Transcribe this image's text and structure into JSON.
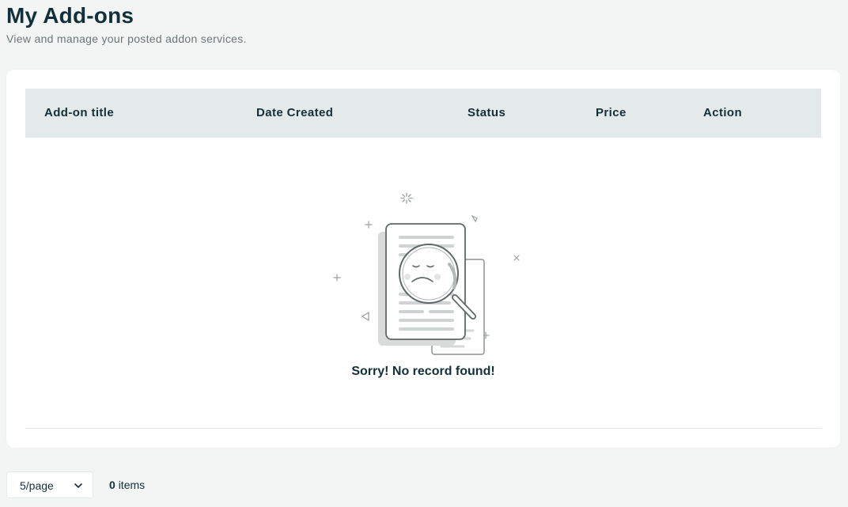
{
  "header": {
    "title": "My Add-ons",
    "subtitle": "View and manage your posted addon services."
  },
  "table": {
    "columns": [
      "Add-on title",
      "Date Created",
      "Status",
      "Price",
      "Action"
    ],
    "rows": []
  },
  "empty_state": {
    "illustration": "document-magnifier-sad-icon",
    "message": "Sorry! No record found!"
  },
  "pagination": {
    "page_size": "5/page",
    "items_count": "0",
    "items_label": "items"
  },
  "colors": {
    "background": "#f3f5f4",
    "header_bg": "#e4e9e9",
    "text": "#12303a",
    "muted": "#6b7676"
  }
}
